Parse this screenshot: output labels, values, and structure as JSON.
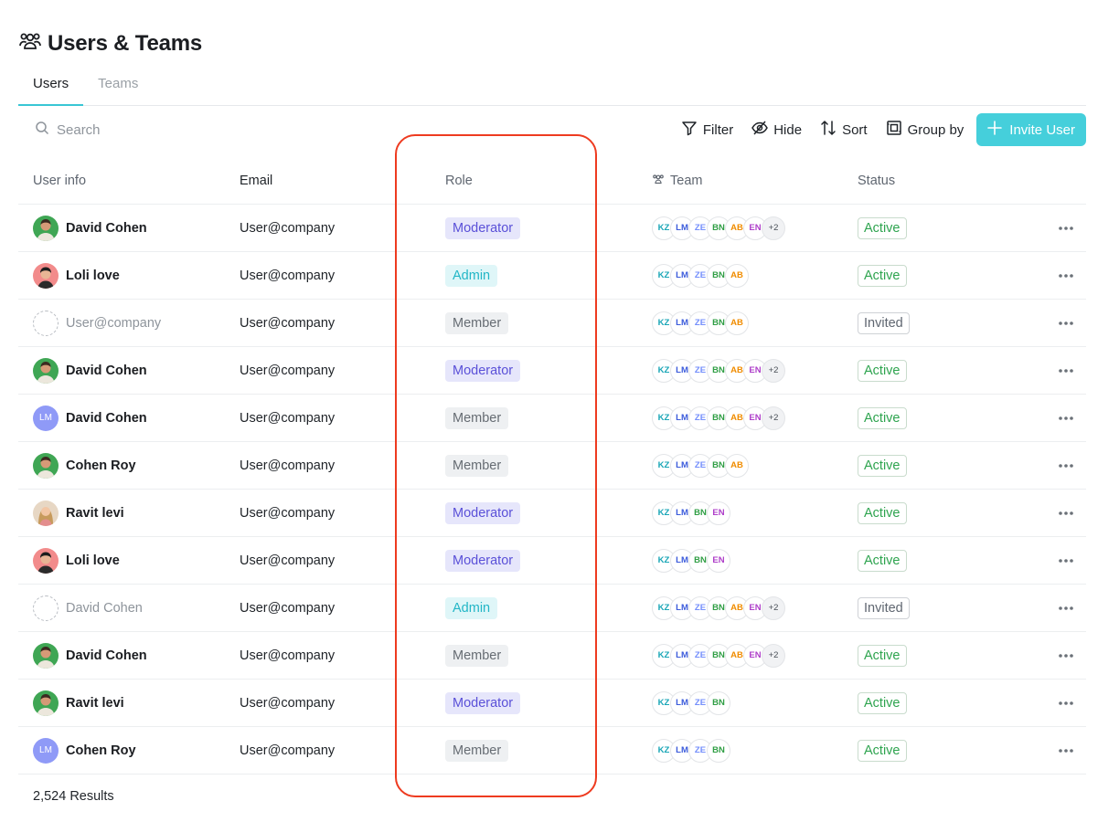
{
  "page": {
    "title": "Users & Teams"
  },
  "tabs": [
    {
      "label": "Users",
      "active": true
    },
    {
      "label": "Teams",
      "active": false
    }
  ],
  "toolbar": {
    "search_placeholder": "Search",
    "filter_label": "Filter",
    "hide_label": "Hide",
    "sort_label": "Sort",
    "group_label": "Group by",
    "invite_label": "Invite User"
  },
  "columns": {
    "user_info": "User info",
    "email": "Email",
    "role": "Role",
    "team": "Team",
    "status": "Status"
  },
  "team_colors": {
    "KZ": "#1aa6b7",
    "LM": "#3b5bdb",
    "ZE": "#748ffc",
    "BN": "#2f9e44",
    "AB": "#f08c00",
    "EN": "#ae3ec9"
  },
  "rows": [
    {
      "name": "David Cohen",
      "avatar": "photo-green",
      "email": "User@company",
      "role": "Moderator",
      "teams": [
        "KZ",
        "LM",
        "ZE",
        "BN",
        "AB",
        "EN"
      ],
      "more": "+2",
      "status": "Active"
    },
    {
      "name": "Loli love",
      "avatar": "photo-pink",
      "email": "User@company",
      "role": "Admin",
      "teams": [
        "KZ",
        "LM",
        "ZE",
        "BN",
        "AB"
      ],
      "more": "",
      "status": "Active"
    },
    {
      "name": "User@company",
      "avatar": "placeholder",
      "email": "User@company",
      "role": "Member",
      "teams": [
        "KZ",
        "LM",
        "ZE",
        "BN",
        "AB"
      ],
      "more": "",
      "status": "Invited"
    },
    {
      "name": "David Cohen",
      "avatar": "photo-green",
      "email": "User@company",
      "role": "Moderator",
      "teams": [
        "KZ",
        "LM",
        "ZE",
        "BN",
        "AB",
        "EN"
      ],
      "more": "+2",
      "status": "Active"
    },
    {
      "name": "David Cohen",
      "avatar": "initials",
      "initials": "LM",
      "email": "User@company",
      "role": "Member",
      "teams": [
        "KZ",
        "LM",
        "ZE",
        "BN",
        "AB",
        "EN"
      ],
      "more": "+2",
      "status": "Active"
    },
    {
      "name": "Cohen Roy",
      "avatar": "photo-green",
      "email": "User@company",
      "role": "Member",
      "teams": [
        "KZ",
        "LM",
        "ZE",
        "BN",
        "AB"
      ],
      "more": "",
      "status": "Active"
    },
    {
      "name": "Ravit levi",
      "avatar": "photo-beige",
      "email": "User@company",
      "role": "Moderator",
      "teams": [
        "KZ",
        "LM",
        "BN",
        "EN"
      ],
      "more": "",
      "status": "Active"
    },
    {
      "name": "Loli love",
      "avatar": "photo-pink",
      "email": "User@company",
      "role": "Moderator",
      "teams": [
        "KZ",
        "LM",
        "BN",
        "EN"
      ],
      "more": "",
      "status": "Active"
    },
    {
      "name": "David Cohen",
      "avatar": "placeholder",
      "email": "User@company",
      "role": "Admin",
      "teams": [
        "KZ",
        "LM",
        "ZE",
        "BN",
        "AB",
        "EN"
      ],
      "more": "+2",
      "status": "Invited"
    },
    {
      "name": "David Cohen",
      "avatar": "photo-green",
      "email": "User@company",
      "role": "Member",
      "teams": [
        "KZ",
        "LM",
        "ZE",
        "BN",
        "AB",
        "EN"
      ],
      "more": "+2",
      "status": "Active"
    },
    {
      "name": "Ravit levi",
      "avatar": "photo-green",
      "email": "User@company",
      "role": "Moderator",
      "teams": [
        "KZ",
        "LM",
        "ZE",
        "BN"
      ],
      "more": "",
      "status": "Active"
    },
    {
      "name": "Cohen Roy",
      "avatar": "initials",
      "initials": "LM",
      "email": "User@company",
      "role": "Member",
      "teams": [
        "KZ",
        "LM",
        "ZE",
        "BN"
      ],
      "more": "",
      "status": "Active"
    }
  ],
  "footer": {
    "results": "2,524 Results"
  }
}
